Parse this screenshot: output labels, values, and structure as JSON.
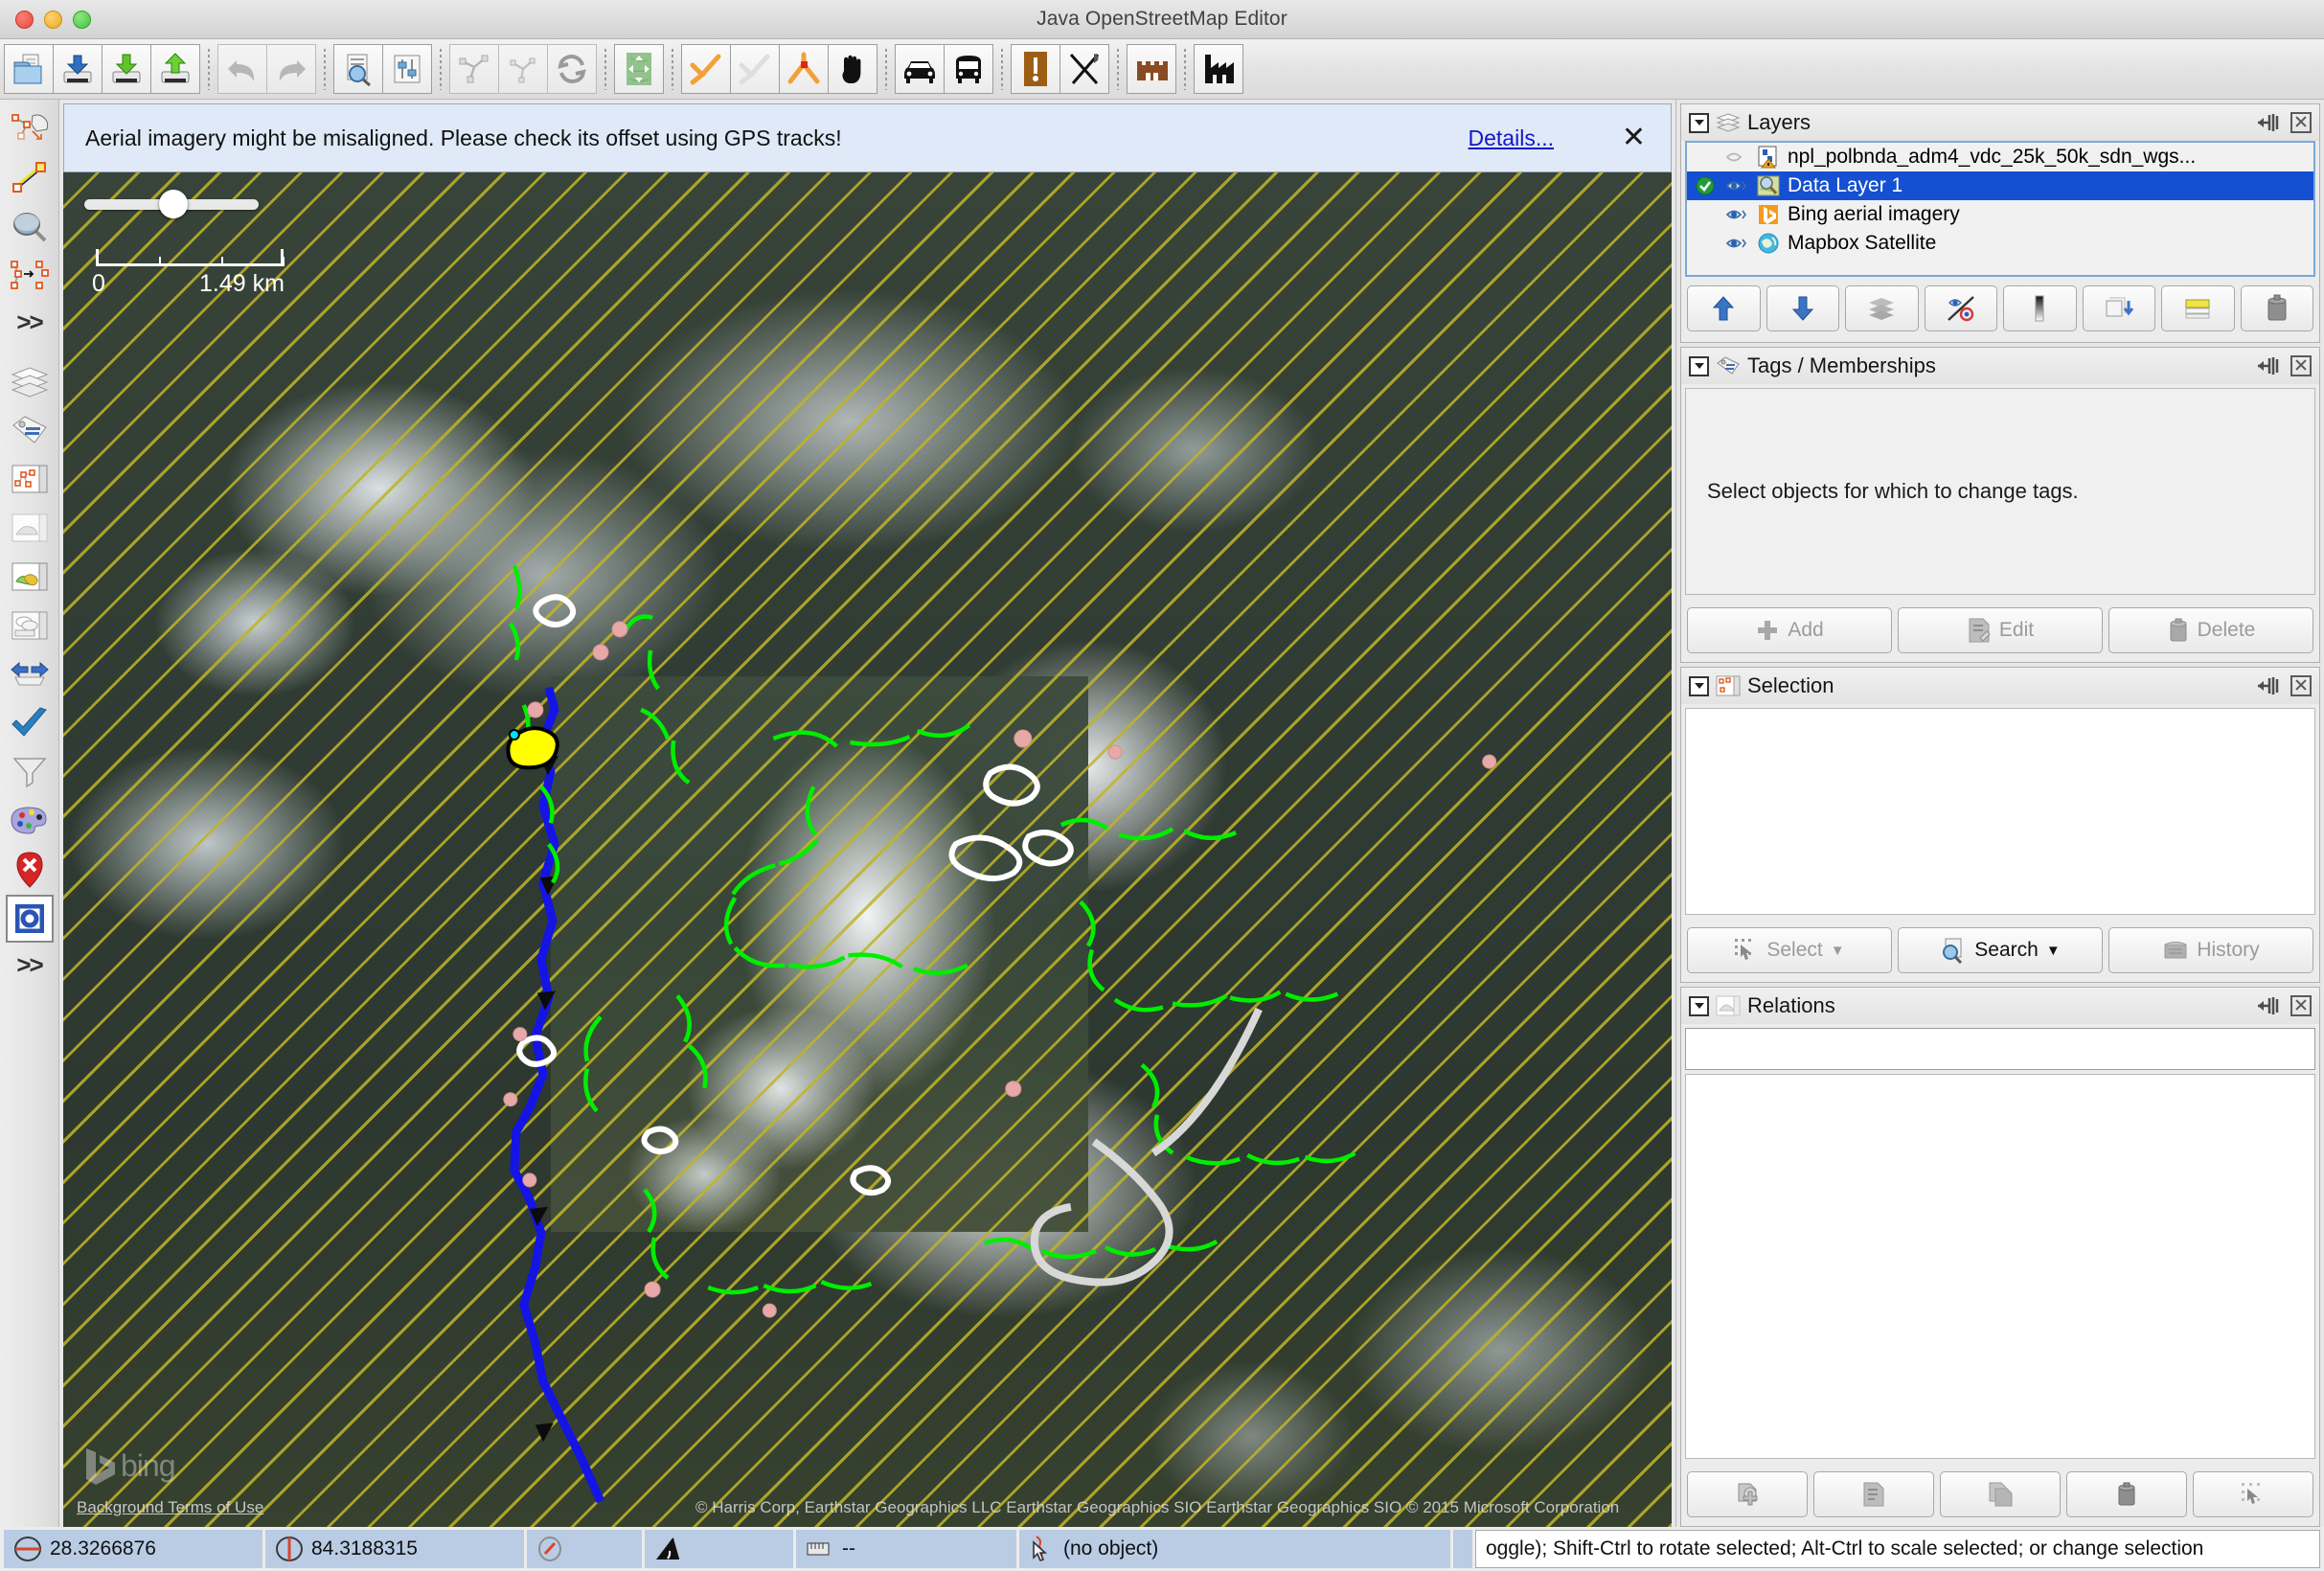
{
  "window": {
    "title": "Java OpenStreetMap Editor",
    "traffic": [
      "close",
      "minimize",
      "maximize"
    ]
  },
  "toolbar": {
    "groups": [
      {
        "buttons": [
          {
            "name": "open-file-button",
            "icon": "folder-open-icon",
            "tooltip": "Open"
          },
          {
            "name": "download-from-osm-button",
            "icon": "download-arrow-disk-icon",
            "tooltip": "Download"
          },
          {
            "name": "save-button",
            "icon": "save-green-down-icon",
            "tooltip": "Save"
          },
          {
            "name": "upload-button",
            "icon": "upload-green-up-icon",
            "tooltip": "Upload"
          }
        ]
      },
      {
        "buttons": [
          {
            "name": "undo-button",
            "icon": "undo-arrow-icon",
            "disabled": true
          },
          {
            "name": "redo-button",
            "icon": "redo-arrow-icon",
            "disabled": true
          }
        ]
      },
      {
        "buttons": [
          {
            "name": "preferences-button",
            "icon": "document-magnifier-icon"
          },
          {
            "name": "settings-button",
            "icon": "sliders-icon"
          }
        ]
      },
      {
        "buttons": [
          {
            "name": "update-data-button",
            "icon": "nodes-scissors-icon",
            "disabled": true
          },
          {
            "name": "update-selection-button",
            "icon": "nodes-small-icon",
            "disabled": true
          },
          {
            "name": "update-modified-button",
            "icon": "refresh-arrows-icon",
            "disabled": true
          }
        ]
      },
      {
        "buttons": [
          {
            "name": "jump-to-position-button",
            "icon": "map-arrows-icon"
          }
        ]
      },
      {
        "buttons": [
          {
            "name": "split-way-button",
            "icon": "way-orange-icon"
          },
          {
            "name": "combine-way-button",
            "icon": "way-grey-icon",
            "disabled": true
          },
          {
            "name": "reverse-way-button",
            "icon": "way-orange-node-icon"
          },
          {
            "name": "unglue-button",
            "icon": "hand-black-icon"
          }
        ]
      },
      {
        "buttons": [
          {
            "name": "car-preset-button",
            "icon": "car-icon"
          },
          {
            "name": "bus-preset-button",
            "icon": "bus-icon"
          }
        ]
      },
      {
        "buttons": [
          {
            "name": "validator-button",
            "icon": "warning-exclamation-icon"
          },
          {
            "name": "restaurant-preset-button",
            "icon": "fork-knife-icon"
          }
        ]
      },
      {
        "buttons": [
          {
            "name": "castle-preset-button",
            "icon": "castle-icon"
          }
        ]
      },
      {
        "buttons": [
          {
            "name": "industrial-preset-button",
            "icon": "factory-icon"
          }
        ]
      }
    ]
  },
  "left_toolbar": {
    "items": [
      {
        "name": "select-mode-button",
        "icon": "select-hand-nodes-icon",
        "selected": false
      },
      {
        "name": "draw-mode-button",
        "icon": "draw-line-icon",
        "selected": false
      },
      {
        "name": "zoom-mode-button",
        "icon": "magnifier-icon",
        "selected": false
      },
      {
        "name": "improve-way-accuracy-button",
        "icon": "nodes-to-nodes-icon",
        "selected": false
      },
      {
        "name": "more-modes-button",
        "icon": "chevrons-right-icon",
        "label": ">>"
      },
      {
        "name": "layers-toggle-button",
        "icon": "layers-stack-icon"
      },
      {
        "name": "tags-toggle-button",
        "icon": "tag-icon"
      },
      {
        "name": "selection-toggle-button",
        "icon": "selection-panel-icon"
      },
      {
        "name": "relations-toggle-button",
        "icon": "relations-panel-icon"
      },
      {
        "name": "authors-toggle-button",
        "icon": "authors-panel-icon"
      },
      {
        "name": "conflicts-toggle-button",
        "icon": "conflicts-panel-icon"
      },
      {
        "name": "validation-toggle-button",
        "icon": "blue-arrows-icon"
      },
      {
        "name": "changeset-toggle-button",
        "icon": "blue-check-icon"
      },
      {
        "name": "filter-toggle-button",
        "icon": "funnel-icon"
      },
      {
        "name": "map-paint-styles-button",
        "icon": "palette-icon"
      },
      {
        "name": "notes-toggle-button",
        "icon": "red-pin-x-icon"
      },
      {
        "name": "imagery-offset-button",
        "icon": "blue-square-ring-icon",
        "selected": true
      },
      {
        "name": "more-panels-button",
        "icon": "chevrons-right-icon",
        "label": ">>"
      }
    ]
  },
  "notice": {
    "message": "Aerial imagery might be misaligned. Please check its offset using GPS tracks!",
    "link": "Details...",
    "close": "✕"
  },
  "map": {
    "scale": {
      "min_label": "0",
      "max_label": "1.49 km"
    },
    "brand": "bing",
    "attribution_left": "Background Terms of Use",
    "attribution_right": "© Harris Corp, Earthstar Geographics LLC  Earthstar Geographics  SIO  Earthstar Geographics  SIO © 2015 Microsoft Corporation",
    "colors": {
      "river": "#1414e6",
      "track": "#00ee00",
      "building_outline": "#ffffff",
      "node_pink": "#e7a8a8",
      "selected_yellow": "#ffff00",
      "hatch_yellow": "#bcb428",
      "road_grey": "#d8d8d8"
    }
  },
  "dock": {
    "layers": {
      "title": "Layers",
      "icon": "layers-stack-icon",
      "pin": "pin-icon",
      "close": "close-icon",
      "items": [
        {
          "label": "npl_polbnda_adm4_vdc_25k_50k_sdn_wgs...",
          "icon": "gpx-warning-icon",
          "visible": true,
          "active": false,
          "selected": false
        },
        {
          "label": "Data Layer 1",
          "icon": "data-layer-icon",
          "visible": true,
          "active": true,
          "selected": true
        },
        {
          "label": "Bing aerial imagery",
          "icon": "bing-layer-icon",
          "visible": true,
          "active": false,
          "selected": false
        },
        {
          "label": "Mapbox Satellite",
          "icon": "mapbox-layer-icon",
          "visible": true,
          "active": false,
          "selected": false
        }
      ],
      "buttons": [
        {
          "name": "layer-move-up-button",
          "icon": "blue-arrow-up-icon"
        },
        {
          "name": "layer-move-down-button",
          "icon": "blue-arrow-down-icon"
        },
        {
          "name": "layer-duplicate-button",
          "icon": "grey-layers-icon",
          "disabled": true
        },
        {
          "name": "layer-toggle-visibility-button",
          "icon": "eye-slash-icon"
        },
        {
          "name": "layer-opacity-button",
          "icon": "gradient-bar-icon"
        },
        {
          "name": "layer-merge-button",
          "icon": "merge-layers-icon"
        },
        {
          "name": "layer-properties-button",
          "icon": "yellow-layers-icon"
        },
        {
          "name": "layer-delete-button",
          "icon": "trash-icon"
        }
      ]
    },
    "tags": {
      "title": "Tags / Memberships",
      "icon": "tag-icon",
      "hint": "Select objects for which to change tags.",
      "buttons": [
        {
          "name": "tag-add-button",
          "label": "Add",
          "icon": "plus-icon",
          "disabled": true
        },
        {
          "name": "tag-edit-button",
          "label": "Edit",
          "icon": "edit-document-icon",
          "disabled": true
        },
        {
          "name": "tag-delete-button",
          "label": "Delete",
          "icon": "trash-icon",
          "disabled": true
        }
      ]
    },
    "selection": {
      "title": "Selection",
      "icon": "selection-panel-icon",
      "items": [],
      "buttons": [
        {
          "name": "selection-select-button",
          "label": "Select",
          "icon": "marquee-cursor-icon",
          "caret": "▼",
          "disabled": true
        },
        {
          "name": "selection-search-button",
          "label": "Search",
          "icon": "search-icon",
          "caret": "▼",
          "disabled": false
        },
        {
          "name": "selection-history-button",
          "label": "History",
          "icon": "history-icon",
          "disabled": true
        }
      ]
    },
    "relations": {
      "title": "Relations",
      "icon": "relations-panel-icon",
      "filter_value": "",
      "items": [],
      "buttons": [
        {
          "name": "relation-new-button",
          "icon": "new-relation-icon"
        },
        {
          "name": "relation-edit-button",
          "icon": "edit-document-icon",
          "disabled": true
        },
        {
          "name": "relation-duplicate-button",
          "icon": "duplicate-relation-icon",
          "disabled": true
        },
        {
          "name": "relation-delete-button",
          "icon": "trash-icon",
          "disabled": true
        },
        {
          "name": "relation-select-members-button",
          "icon": "marquee-cursor-icon",
          "disabled": true
        }
      ]
    }
  },
  "status": {
    "latitude": "28.3266876",
    "longitude": "84.3188315",
    "heading": "",
    "angle": "",
    "distance": "--",
    "object": "(no object)",
    "help": "oggle); Shift-Ctrl to rotate selected; Alt-Ctrl to scale selected; or change selection"
  }
}
